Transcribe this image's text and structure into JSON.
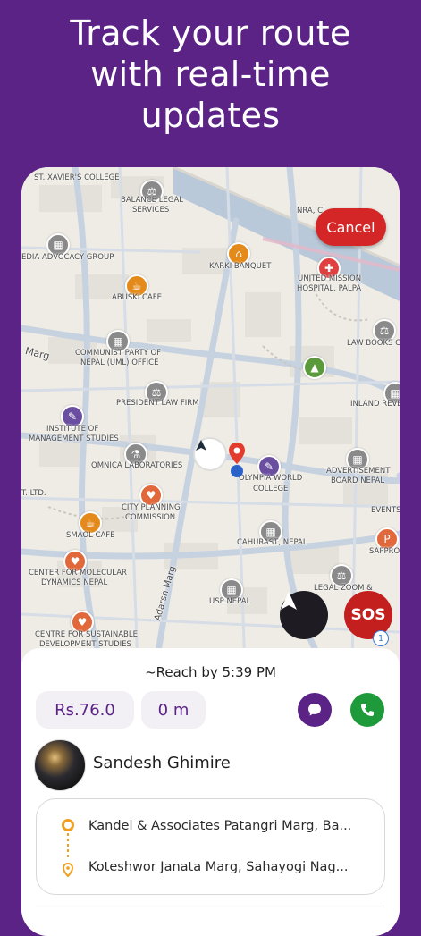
{
  "headline": {
    "line1": "Track your route",
    "line2": "with real-time",
    "line3": "updates"
  },
  "map": {
    "places": {
      "st_xaviers": "ST. XAVIER'S COLLEGE",
      "balance_legal_1": "BALANCE LEGAL",
      "balance_legal_2": "SERVICES",
      "nra": "NRA, CI...",
      "media_advocacy": "EDIA ADVOCACY GROUP",
      "karki_banquet": "KARKI BANQUET",
      "united_mission_1": "UNITED MISSION",
      "united_mission_2": "HOSPITAL, PALPA",
      "abuski": "ABUSKI CAFE",
      "law_books": "LAW BOOKS CE",
      "marg": "Marg",
      "communist_1": "COMMUNIST PARTY OF",
      "communist_2": "NEPAL (UML) OFFICE",
      "president_law": "PRESIDENT LAW FIRM",
      "inland": "INLAND REVEN",
      "institute_1": "INSTITUTE OF",
      "institute_2": "MANAGEMENT STUDIES",
      "omnica": "OMNICA LABORATORIES",
      "olympia_1": "OLYMPIA WORLD",
      "olympia_2": "COLLEGE",
      "advert_1": "ADVERTISEMENT",
      "advert_2": "BOARD NEPAL",
      "ltd": "T. LTD.",
      "events": "EVENTS",
      "city_planning_1": "CITY PLANNING",
      "city_planning_2": "COMMISSION",
      "smaol": "SMAOL CAFE",
      "cahurast": "CAHURAST, NEPAL",
      "sappro": "SAPPRO",
      "molecular_1": "CENTER FOR MOLECULAR",
      "molecular_2": "DYNAMICS NEPAL",
      "adarsh": "Adarsh Marg",
      "legal_zoom": "LEGAL ZOOM &",
      "usp": "USP NEPAL",
      "sustainable_1": "CENTRE FOR SUSTAINABLE",
      "sustainable_2": "DEVELOPMENT STUDIES"
    },
    "cancel_label": "Cancel",
    "sos_label": "SOS",
    "badge": "1"
  },
  "trip": {
    "eta": "~Reach by 5:39 PM",
    "fare": "Rs.76.0",
    "distance": "0 m",
    "driver_name": "Sandesh Ghimire",
    "pickup": "Kandel & Associates Patangri Marg, Ba...",
    "dropoff": "Koteshwor Janata Marg, Sahayogi Nag..."
  },
  "colors": {
    "brand": "#5b2385",
    "cancel": "#d42626",
    "sos": "#c41f1f",
    "call": "#1f9a3a",
    "route_orange": "#f0a020"
  }
}
